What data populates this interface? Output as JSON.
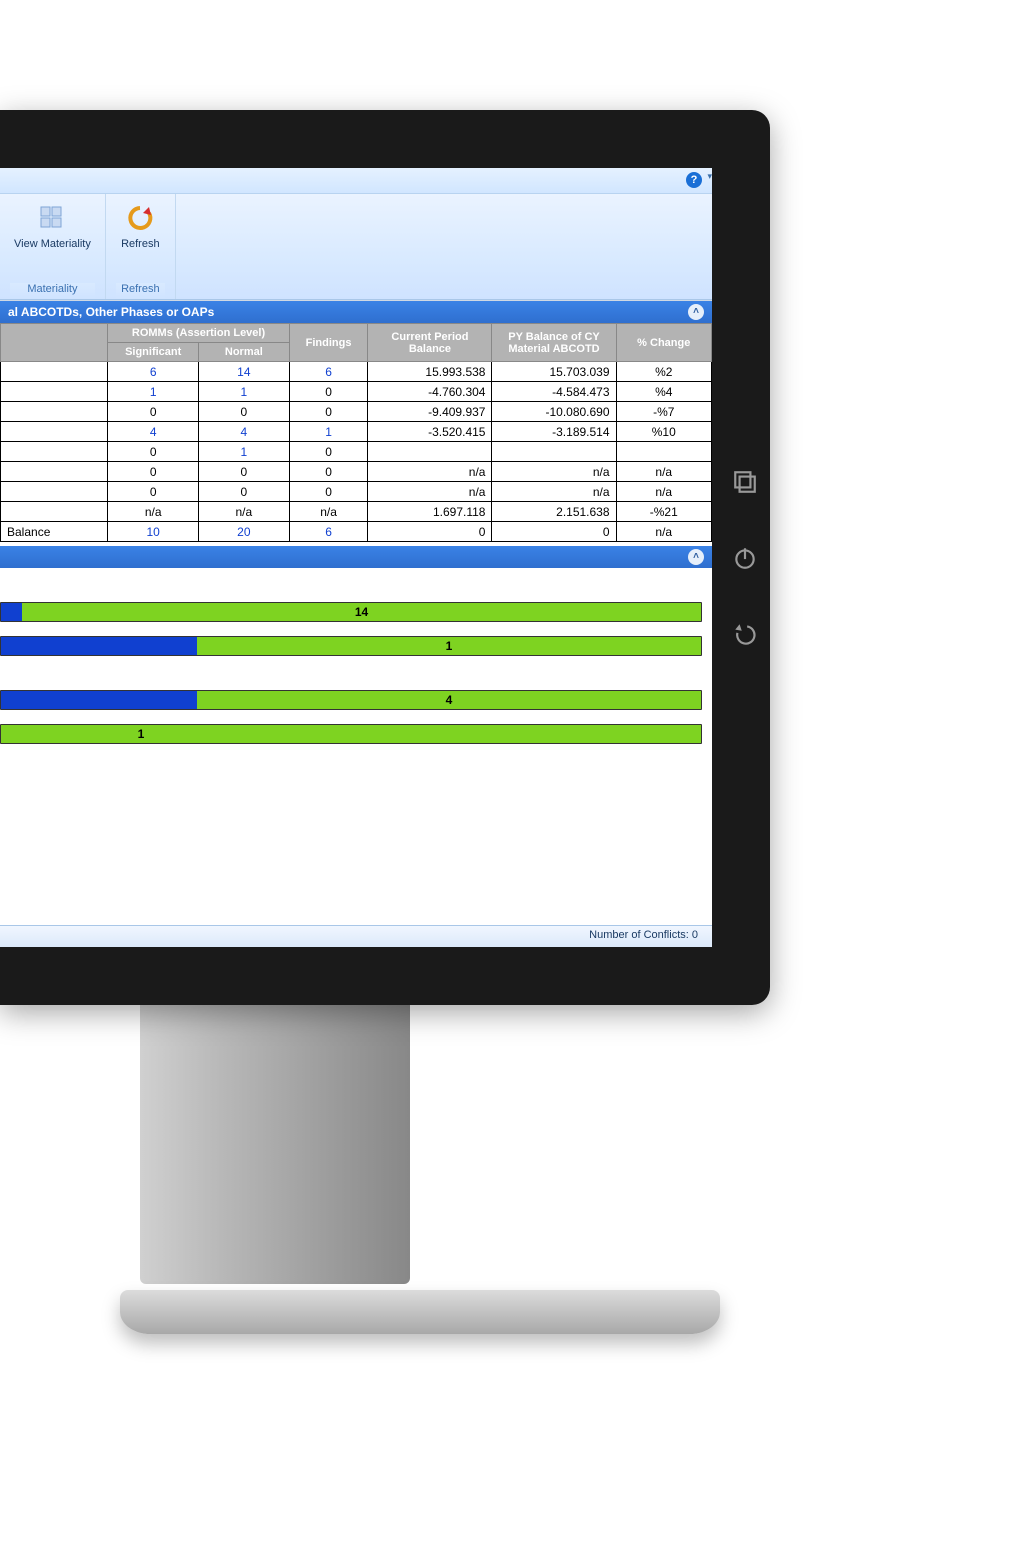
{
  "ribbon": {
    "groups": [
      {
        "button_label": "View Materiality",
        "group_label": "Materiality"
      },
      {
        "button_label": "Refresh",
        "group_label": "Refresh"
      }
    ]
  },
  "panel1": {
    "title_fragment": "al ABCOTDs, Other Phases or OAPs",
    "header_group": "ROMMs (Assertion Level)",
    "columns": {
      "row_label": "",
      "significant": "Significant",
      "normal": "Normal",
      "findings": "Findings",
      "current": "Current Period Balance",
      "py": "PY Balance of CY Material ABCOTD",
      "change": "% Change"
    },
    "rows": [
      {
        "label": "",
        "sig": "6",
        "norm": "14",
        "find": "6",
        "cur": "15.993.538",
        "py": "15.703.039",
        "chg": "%2",
        "sig_link": true,
        "norm_link": true,
        "find_link": true
      },
      {
        "label": "",
        "sig": "1",
        "norm": "1",
        "find": "0",
        "cur": "-4.760.304",
        "py": "-4.584.473",
        "chg": "%4",
        "sig_link": true,
        "norm_link": true
      },
      {
        "label": "",
        "sig": "0",
        "norm": "0",
        "find": "0",
        "cur": "-9.409.937",
        "py": "-10.080.690",
        "chg": "-%7"
      },
      {
        "label": "",
        "sig": "4",
        "norm": "4",
        "find": "1",
        "cur": "-3.520.415",
        "py": "-3.189.514",
        "chg": "%10",
        "sig_link": true,
        "norm_link": true,
        "find_link": true
      },
      {
        "label": "",
        "sig": "0",
        "norm": "1",
        "find": "0",
        "cur": "",
        "py": "",
        "chg": "",
        "norm_link": true
      },
      {
        "label": "",
        "sig": "0",
        "norm": "0",
        "find": "0",
        "cur": "n/a",
        "py": "n/a",
        "chg": "n/a"
      },
      {
        "label": "",
        "sig": "0",
        "norm": "0",
        "find": "0",
        "cur": "n/a",
        "py": "n/a",
        "chg": "n/a"
      },
      {
        "label": "",
        "sig": "n/a",
        "norm": "n/a",
        "find": "n/a",
        "cur": "1.697.118",
        "py": "2.151.638",
        "chg": "-%21"
      },
      {
        "label": "Balance",
        "sig": "10",
        "norm": "20",
        "find": "6",
        "cur": "0",
        "py": "0",
        "chg": "n/a",
        "sig_link": true,
        "norm_link": true,
        "find_link": true
      }
    ]
  },
  "chart_data": {
    "type": "bar",
    "title": "",
    "series": [
      {
        "name": "Significant",
        "color": "#1040d0"
      },
      {
        "name": "Normal",
        "color": "#7ed321"
      }
    ],
    "bars": [
      {
        "blue_pct": 3,
        "green_pct": 97,
        "label": "14"
      },
      {
        "blue_pct": 28,
        "green_pct": 72,
        "label": "1"
      },
      {
        "blue_pct": 28,
        "green_pct": 72,
        "label": "4"
      },
      {
        "blue_pct": 0,
        "green_pct": 100,
        "label": "1",
        "label_align": "left"
      }
    ]
  },
  "status": {
    "conflicts_label": "Number of Conflicts:",
    "conflicts_value": "0"
  },
  "help_tooltip": "?"
}
